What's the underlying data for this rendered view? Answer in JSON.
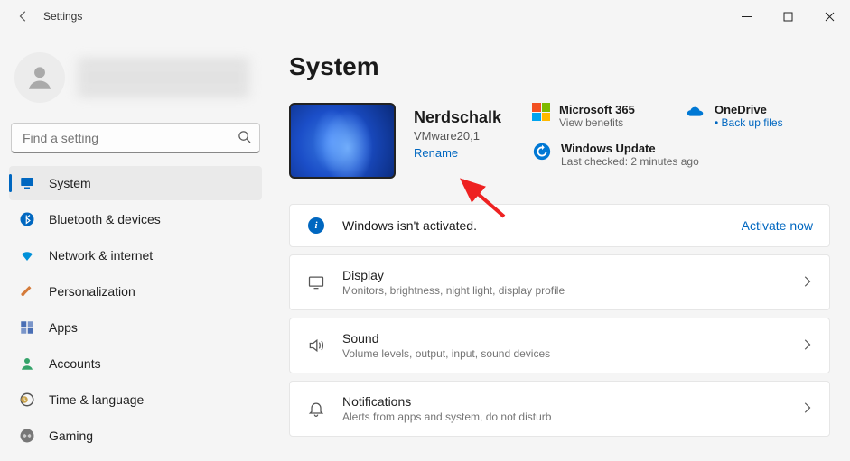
{
  "window": {
    "title": "Settings"
  },
  "profile": {},
  "search": {
    "placeholder": "Find a setting"
  },
  "nav": [
    {
      "label": "System",
      "icon": "system",
      "active": true
    },
    {
      "label": "Bluetooth & devices",
      "icon": "bluetooth"
    },
    {
      "label": "Network & internet",
      "icon": "wifi"
    },
    {
      "label": "Personalization",
      "icon": "brush"
    },
    {
      "label": "Apps",
      "icon": "apps"
    },
    {
      "label": "Accounts",
      "icon": "account"
    },
    {
      "label": "Time & language",
      "icon": "clock"
    },
    {
      "label": "Gaming",
      "icon": "gaming"
    }
  ],
  "page": {
    "heading": "System",
    "device": {
      "name": "Nerdschalk",
      "model": "VMware20,1",
      "rename": "Rename"
    },
    "side": {
      "ms365": {
        "title": "Microsoft 365",
        "sub": "View benefits"
      },
      "onedrive": {
        "title": "OneDrive",
        "sub": "Back up files"
      },
      "update": {
        "title": "Windows Update",
        "sub": "Last checked: 2 minutes ago"
      }
    },
    "activation": {
      "text": "Windows isn't activated.",
      "action": "Activate now"
    },
    "list": [
      {
        "title": "Display",
        "sub": "Monitors, brightness, night light, display profile",
        "icon": "display"
      },
      {
        "title": "Sound",
        "sub": "Volume levels, output, input, sound devices",
        "icon": "sound"
      },
      {
        "title": "Notifications",
        "sub": "Alerts from apps and system, do not disturb",
        "icon": "bell"
      }
    ]
  }
}
